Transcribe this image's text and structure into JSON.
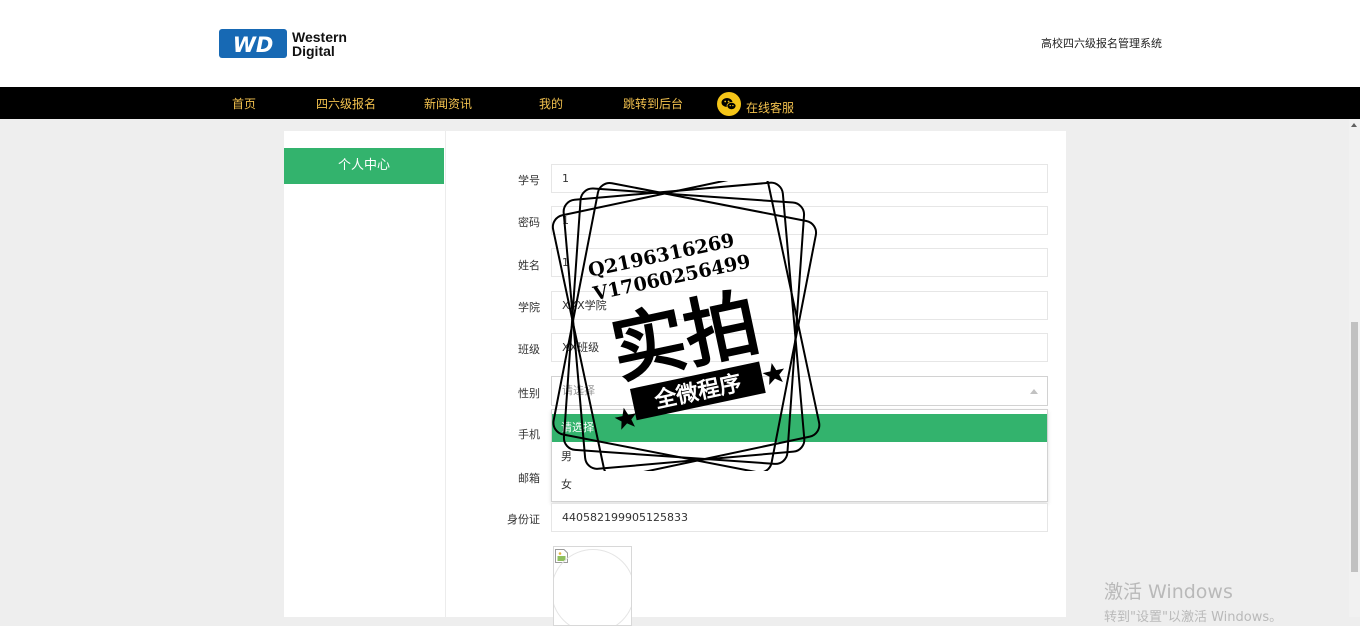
{
  "header": {
    "logo_line1": "Western",
    "logo_line2": "Digital",
    "logo_mark": "WD",
    "site_title": "高校四六级报名管理系统"
  },
  "nav": {
    "items": [
      "首页",
      "四六级报名",
      "新闻资讯",
      "我的",
      "跳转到后台"
    ],
    "kefu_label": "在线客服",
    "kefu_icon": "wechat-icon",
    "text_color": "#f2c14e"
  },
  "sidebar": {
    "active_item": "个人中心",
    "accent": "#33b36d"
  },
  "form": {
    "student_id_label": "学号",
    "student_id_value": "1",
    "password_label": "密码",
    "password_value": "1",
    "name_label": "姓名",
    "name_value": "1",
    "college_label": "学院",
    "college_value": "XXX学院",
    "class_label": "班级",
    "class_value": "XX班级",
    "gender_label": "性别",
    "gender_placeholder": "请选择",
    "gender_options": [
      "请选择",
      "男",
      "女"
    ],
    "phone_label": "手机",
    "email_label": "邮箱",
    "idcard_label": "身份证",
    "idcard_value": "440582199905125833"
  },
  "stamp": {
    "line1": "Q2196316269",
    "line2": "V17060256499",
    "big_text": "实拍",
    "banner_text": "全微程序"
  },
  "os_watermark": {
    "line1": "激活 Windows",
    "line2": "转到\"设置\"以激活 Windows。"
  }
}
